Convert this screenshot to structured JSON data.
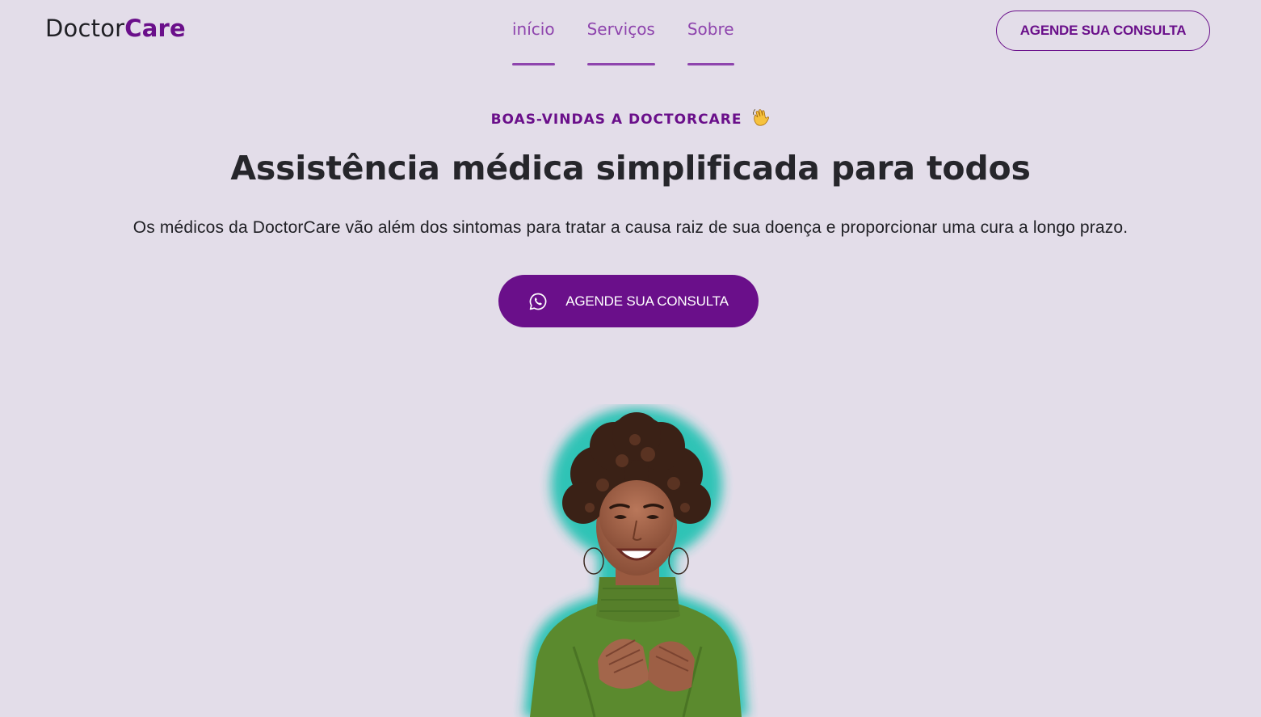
{
  "header": {
    "logo_plain": "Doctor",
    "logo_accent": "Care",
    "nav": [
      {
        "label": "início"
      },
      {
        "label": "Serviços"
      },
      {
        "label": "Sobre"
      }
    ],
    "cta_label": "AGENDE SUA CONSULTA"
  },
  "hero": {
    "eyebrow": "BOAS-VINDAS A DOCTORCARE",
    "eyebrow_icon": "waving-hand-icon",
    "title": "Assistência médica simplificada para todos",
    "text": "Os médicos da DoctorCare vão além dos sintomas para tratar a causa raiz de sua doença e proporcionar uma cura a longo prazo.",
    "cta_label": "AGENDE SUA CONSULTA",
    "cta_icon": "whatsapp-icon",
    "image": "smiling-woman-portrait"
  },
  "colors": {
    "background": "#e3dde9",
    "brand": "#6a0f8a",
    "nav": "#8e44ad",
    "text": "#1f1f24",
    "portrait_glow": "#28c2b4",
    "sweater": "#5b8a2e"
  }
}
